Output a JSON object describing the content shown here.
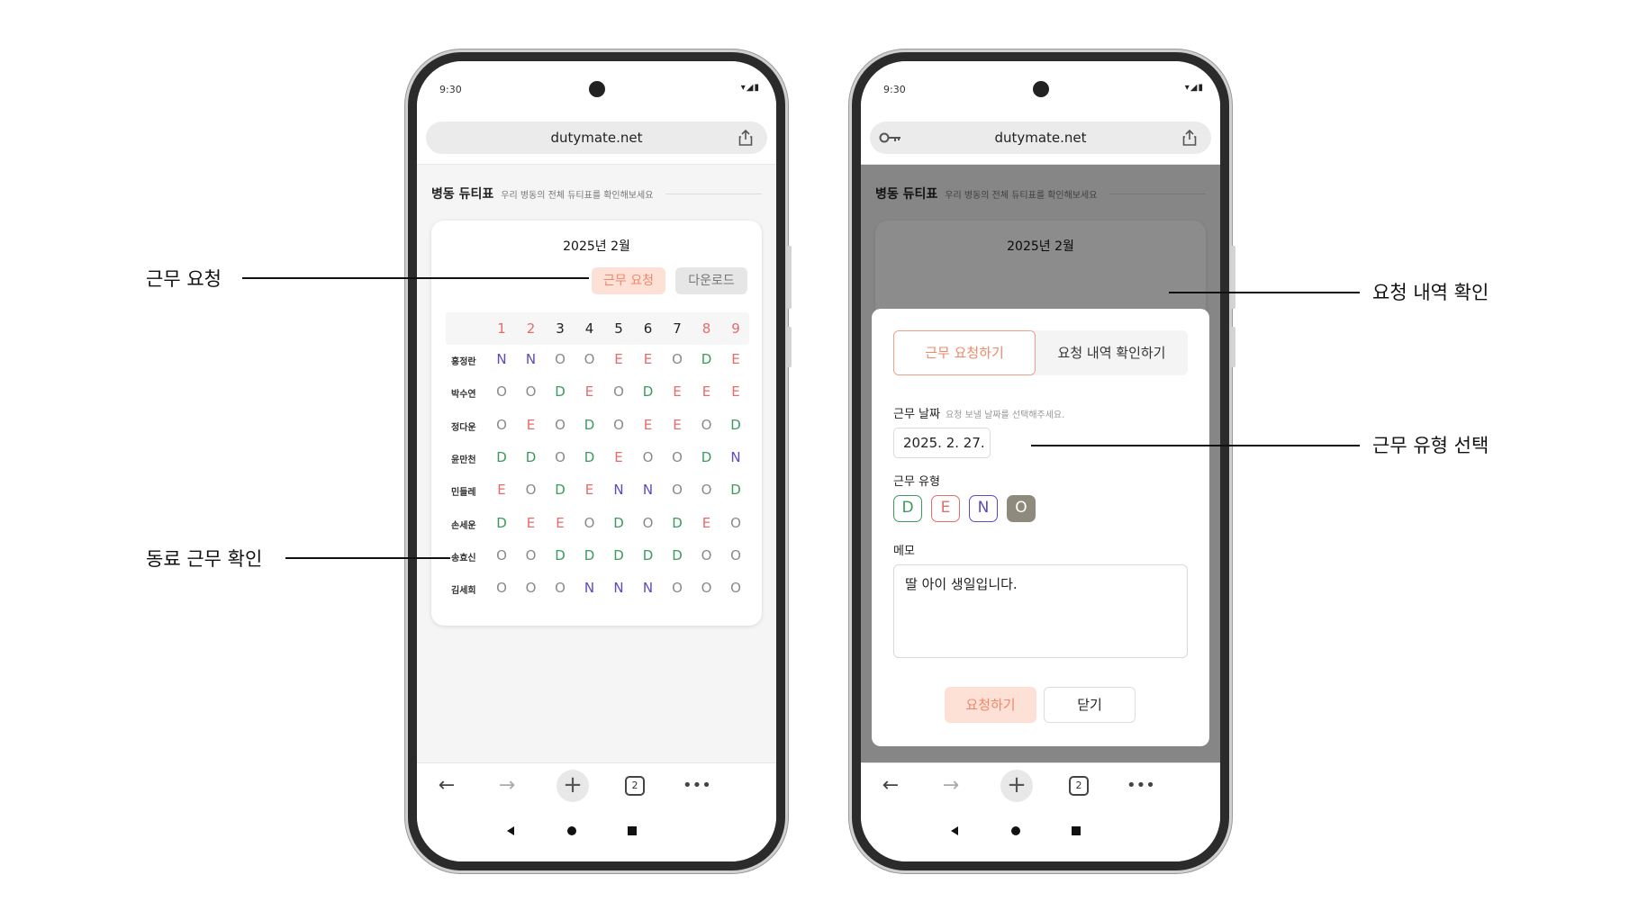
{
  "colors": {
    "d": "#3b9a5e",
    "e": "#e66b6b",
    "n": "#5a4bbf",
    "o": "#8a8a8a",
    "date_weekend": "#e66b6b",
    "date_weekday": "#222222",
    "accent": "#f0876a",
    "accent_bg": "#fde1d6"
  },
  "left_phone": {
    "status": {
      "time": "9:30",
      "icons": "▾◢▮"
    },
    "browser": {
      "url": "dutymate.net",
      "tab_count": "2"
    },
    "page": {
      "title": "병동 듀티표",
      "subtitle": "우리 병동의 전체 듀티표를 확인해보세요"
    },
    "schedule": {
      "month": "2025년 2월",
      "request_button": "근무 요청",
      "download_button": "다운로드",
      "dates": [
        {
          "day": "1",
          "weekend": true
        },
        {
          "day": "2",
          "weekend": true
        },
        {
          "day": "3",
          "weekend": false
        },
        {
          "day": "4",
          "weekend": false
        },
        {
          "day": "5",
          "weekend": false
        },
        {
          "day": "6",
          "weekend": false
        },
        {
          "day": "7",
          "weekend": false
        },
        {
          "day": "8",
          "weekend": true
        },
        {
          "day": "9",
          "weekend": true
        }
      ],
      "rows": [
        {
          "name": "홍정란",
          "duties": [
            "N",
            "N",
            "O",
            "O",
            "E",
            "E",
            "O",
            "D",
            "E"
          ]
        },
        {
          "name": "박수연",
          "duties": [
            "O",
            "O",
            "D",
            "E",
            "O",
            "D",
            "E",
            "E",
            "E"
          ]
        },
        {
          "name": "정다운",
          "duties": [
            "O",
            "E",
            "O",
            "D",
            "O",
            "E",
            "E",
            "O",
            "D"
          ]
        },
        {
          "name": "윤만천",
          "duties": [
            "D",
            "D",
            "O",
            "D",
            "E",
            "O",
            "O",
            "D",
            "N"
          ]
        },
        {
          "name": "민들레",
          "duties": [
            "E",
            "O",
            "D",
            "E",
            "N",
            "N",
            "O",
            "O",
            "D"
          ]
        },
        {
          "name": "손세운",
          "duties": [
            "D",
            "E",
            "E",
            "O",
            "D",
            "O",
            "D",
            "E",
            "O"
          ]
        },
        {
          "name": "송효신",
          "duties": [
            "O",
            "O",
            "D",
            "D",
            "D",
            "D",
            "D",
            "O",
            "O"
          ]
        },
        {
          "name": "김세희",
          "duties": [
            "O",
            "O",
            "O",
            "N",
            "N",
            "N",
            "O",
            "O",
            "O"
          ]
        }
      ]
    }
  },
  "right_phone": {
    "status": {
      "time": "9:30",
      "icons": "▾◢▮"
    },
    "browser": {
      "url": "dutymate.net",
      "tab_count": "2"
    },
    "page": {
      "title": "병동 듀티표",
      "subtitle": "우리 병동의 전체 듀티표를 확인해보세요",
      "month": "2025년 2월"
    },
    "modal": {
      "tab_request": "근무 요청하기",
      "tab_history": "요청 내역 확인하기",
      "date_label": "근무 날짜",
      "date_hint": "요청 보낼 날짜를 선택해주세요.",
      "date_value": "2025. 2. 27.",
      "type_label": "근무 유형",
      "types": [
        {
          "code": "D",
          "selected": false
        },
        {
          "code": "E",
          "selected": false
        },
        {
          "code": "N",
          "selected": false
        },
        {
          "code": "O",
          "selected": true
        }
      ],
      "memo_label": "메모",
      "memo_value": "딸 아이 생일입니다.",
      "submit_button": "요청하기",
      "close_button": "닫기"
    }
  },
  "annotations": {
    "duty_request": "근무 요청",
    "coworker_duty": "동료 근무 확인",
    "request_history": "요청 내역 확인",
    "duty_type_select": "근무 유형 선택"
  }
}
